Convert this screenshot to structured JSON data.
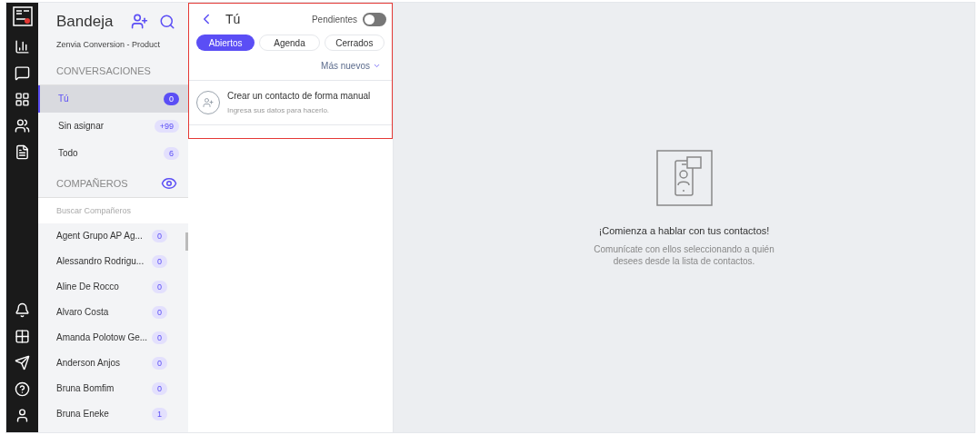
{
  "sidebar": {
    "title": "Bandeja",
    "account": "Zenvia Conversion - Product",
    "conversations_heading": "CONVERSACIONES",
    "conversations": [
      {
        "label": "Tú",
        "count": "0",
        "selected": true
      },
      {
        "label": "Sin asignar",
        "count": "+99",
        "selected": false
      },
      {
        "label": "Todo",
        "count": "6",
        "selected": false
      }
    ],
    "teammates_heading": "COMPAÑEROS",
    "teammate_search": {
      "placeholder": "Buscar Compañeros"
    },
    "teammates": [
      {
        "name": "Agent Grupo AP Ag...",
        "count": "0"
      },
      {
        "name": "Alessandro Rodrigu...",
        "count": "0"
      },
      {
        "name": "Aline De Rocco",
        "count": "0"
      },
      {
        "name": "Alvaro Costa",
        "count": "0"
      },
      {
        "name": "Amanda Polotow Ge...",
        "count": "0"
      },
      {
        "name": "Anderson Anjos",
        "count": "0"
      },
      {
        "name": "Bruna Bomfim",
        "count": "0"
      },
      {
        "name": "Bruna Eneke",
        "count": "1"
      }
    ]
  },
  "list_panel": {
    "title": "Tú",
    "pending": {
      "label": "Pendientes",
      "on": false
    },
    "tabs": [
      {
        "label": "Abiertos",
        "selected": true
      },
      {
        "label": "Agenda",
        "selected": false
      },
      {
        "label": "Cerrados",
        "selected": false
      }
    ],
    "sort": "Más nuevos",
    "create_contact": {
      "title": "Crear un contacto de forma manual",
      "subtitle": "Ingresa sus datos para hacerlo."
    }
  },
  "empty_state": {
    "title": "¡Comienza a hablar con tus contactos!",
    "text": "Comunícate con ellos seleccionando a quién desees desde la lista de contactos."
  }
}
